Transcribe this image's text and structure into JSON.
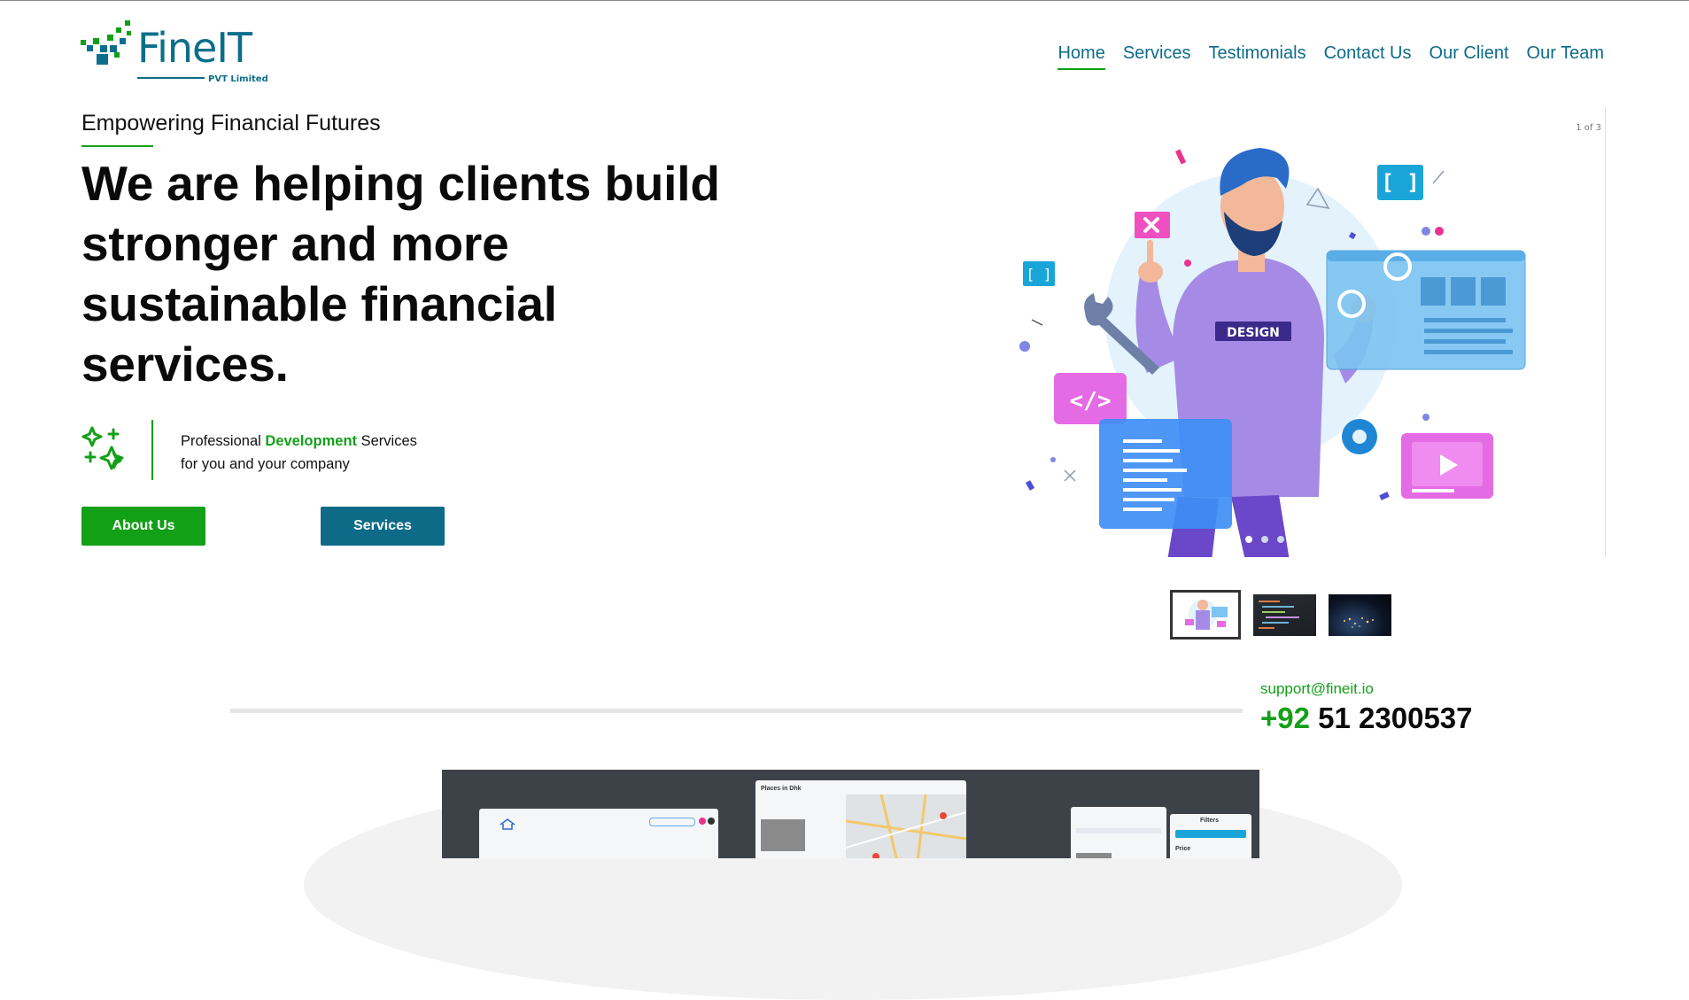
{
  "brand": {
    "name": "FineIT",
    "tagline": "PVT Limited",
    "colors": {
      "green": "#13a018",
      "teal": "#0d6b88"
    }
  },
  "nav": {
    "items": [
      {
        "label": "Home",
        "active": true
      },
      {
        "label": "Services"
      },
      {
        "label": "Testimonials"
      },
      {
        "label": "Contact Us"
      },
      {
        "label": "Our Client"
      },
      {
        "label": "Our Team"
      }
    ]
  },
  "hero": {
    "kicker": "Empowering Financial Futures",
    "headline": "We are helping clients build stronger and more sustainable financial services.",
    "feature": {
      "prefix": "Professional",
      "highlight": "Development",
      "suffix": "Services",
      "line2": "for you and your company",
      "icon": "sparkles-icon"
    },
    "buttons": {
      "about": "About Us",
      "services": "Services"
    }
  },
  "carousel": {
    "counter": "1 of 3",
    "illustration_label": "DESIGN",
    "thumbnails": [
      "design-illustration",
      "code-editor",
      "night-earth"
    ]
  },
  "contact": {
    "email": "support@fineit.io",
    "phone_cc": "+92",
    "phone_number": "51 2300537"
  },
  "preview": {
    "places_title": "Places in Dhk",
    "filters_title": "Filters",
    "price_label": "Price"
  }
}
